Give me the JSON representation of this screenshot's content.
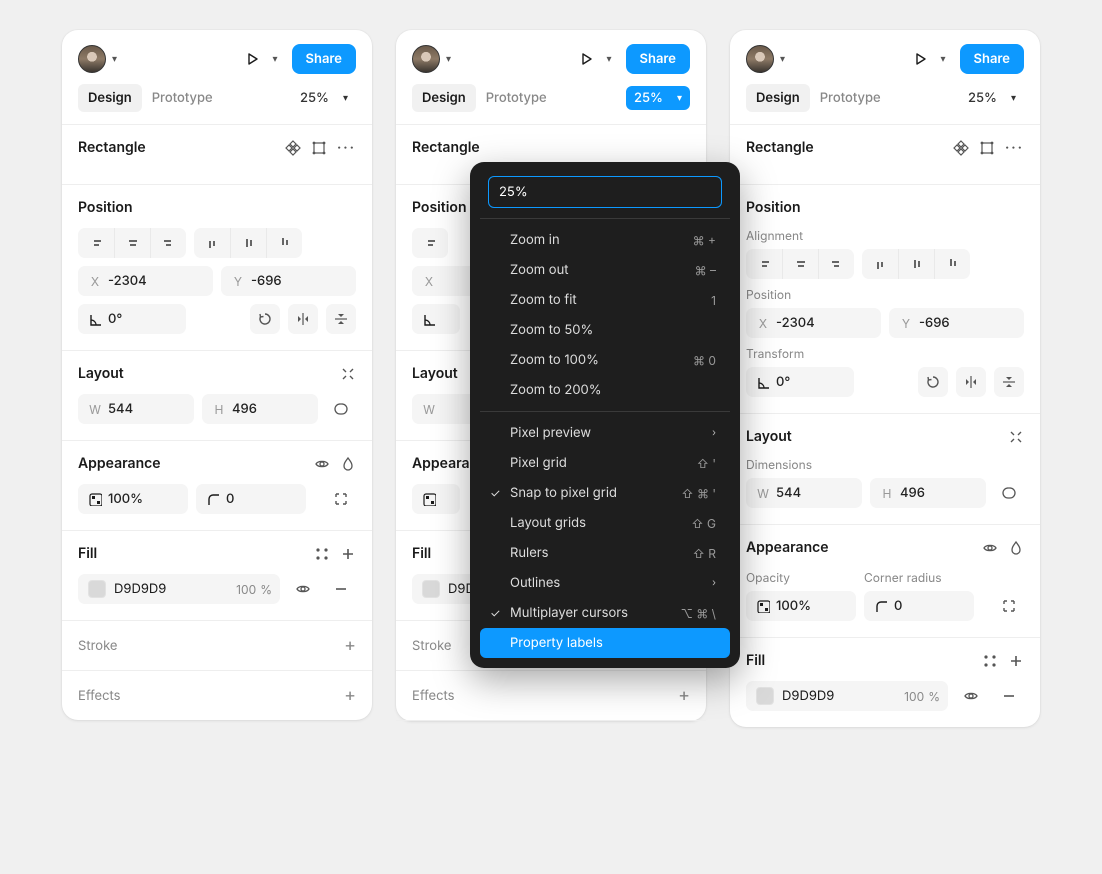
{
  "topbar": {
    "share_label": "Share"
  },
  "tabs": {
    "design": "Design",
    "prototype": "Prototype",
    "zoom_level": "25%"
  },
  "selection": {
    "name": "Rectangle"
  },
  "position": {
    "title": "Position",
    "alignment_label": "Alignment",
    "position_label": "Position",
    "transform_label": "Transform",
    "x_prefix": "X",
    "x_value": "-2304",
    "y_prefix": "Y",
    "y_value": "-696",
    "rotation_value": "0°"
  },
  "layout": {
    "title": "Layout",
    "dimensions_label": "Dimensions",
    "w_prefix": "W",
    "w_value": "544",
    "h_prefix": "H",
    "h_value": "496"
  },
  "appearance": {
    "title": "Appearance",
    "opacity_label": "Opacity",
    "corner_label": "Corner radius",
    "opacity_value": "100%",
    "corner_radius": "0"
  },
  "fill": {
    "title": "Fill",
    "color_hex": "D9D9D9",
    "color_opacity": "100",
    "percent": "%"
  },
  "stroke": {
    "title": "Stroke"
  },
  "effects": {
    "title": "Effects"
  },
  "zoom_menu": {
    "input_value": "25%",
    "items": [
      {
        "label": "Zoom in",
        "shortcut": "⌘ +"
      },
      {
        "label": "Zoom out",
        "shortcut": "⌘ –"
      },
      {
        "label": "Zoom to fit",
        "shortcut": "1"
      },
      {
        "label": "Zoom to 50%"
      },
      {
        "label": "Zoom to 100%",
        "shortcut": "⌘ 0"
      },
      {
        "label": "Zoom to 200%"
      }
    ],
    "items2": [
      {
        "label": "Pixel preview",
        "submenu": true
      },
      {
        "label": "Pixel grid",
        "shortcut": "⇧ '"
      },
      {
        "label": "Snap to pixel grid",
        "shortcut": "⇧ ⌘ '",
        "checked": true
      },
      {
        "label": "Layout grids",
        "shortcut": "⇧ G"
      },
      {
        "label": "Rulers",
        "shortcut": "⇧ R"
      },
      {
        "label": "Outlines",
        "submenu": true
      },
      {
        "label": "Multiplayer cursors",
        "shortcut": "⌥ ⌘ \\",
        "checked": true
      },
      {
        "label": "Property labels",
        "highlight": true
      }
    ]
  }
}
